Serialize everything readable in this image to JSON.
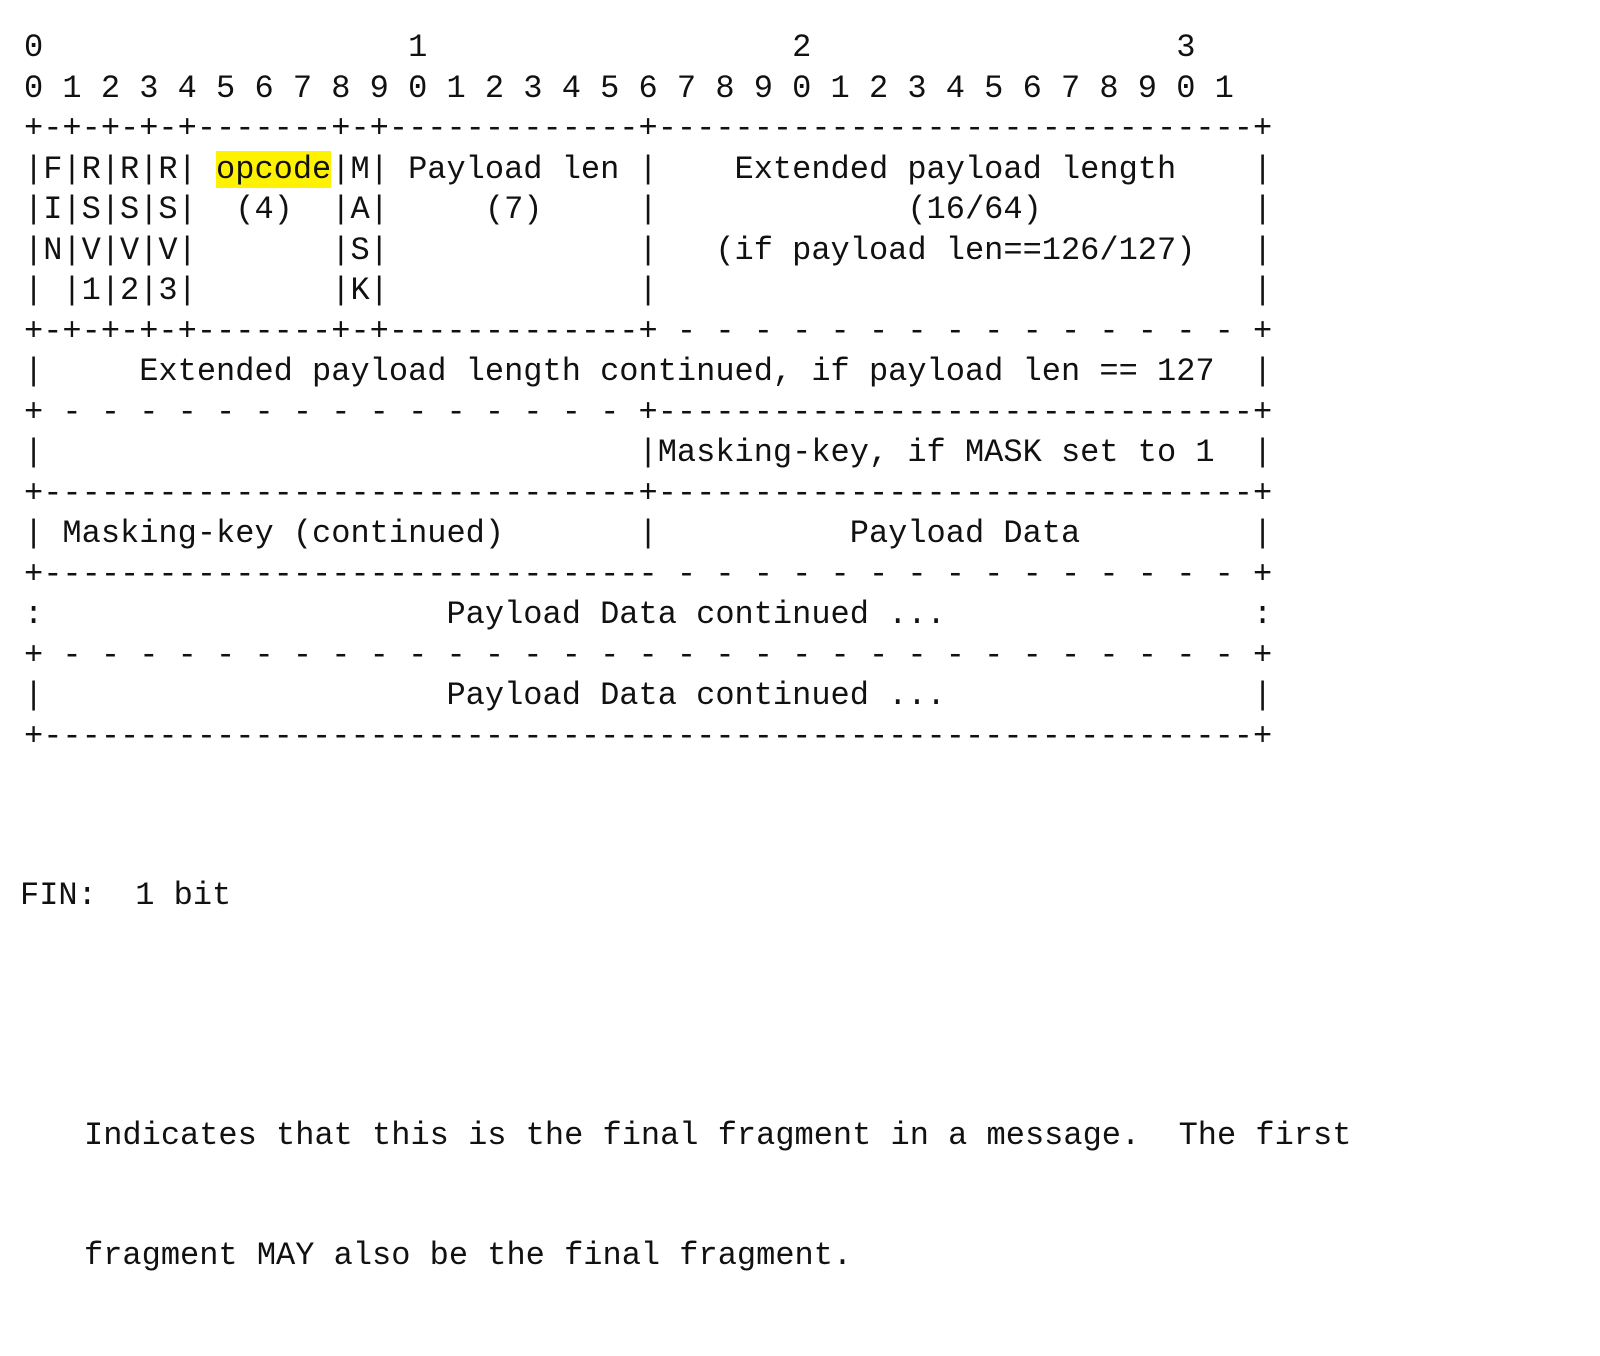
{
  "diagram": {
    "bit_tens": "0                   1                   2                   3",
    "bit_ones": "0 1 2 3 4 5 6 7 8 9 0 1 2 3 4 5 6 7 8 9 0 1 2 3 4 5 6 7 8 9 0 1",
    "border1": "+-+-+-+-+-------+-+-------------+-------------------------------+",
    "hdr1_pre": "|F|R|R|R| ",
    "hdr1_opcode": "opcode",
    "hdr1_post": "|M| Payload len |    Extended payload length    |",
    "hdr2": "|I|S|S|S|  (4)  |A|     (7)     |             (16/64)           |",
    "hdr3": "|N|V|V|V|       |S|             |   (if payload len==126/127)   |",
    "hdr4": "| |1|2|3|       |K|             |                               |",
    "border2": "+-+-+-+-+-------+-+-------------+ - - - - - - - - - - - - - - - +",
    "ext_cont": "|     Extended payload length continued, if payload len == 127  |",
    "border3": "+ - - - - - - - - - - - - - - - +-------------------------------+",
    "mask_row": "|                               |Masking-key, if MASK set to 1  |",
    "border4": "+-------------------------------+-------------------------------+",
    "mask_cont_row": "| Masking-key (continued)       |          Payload Data         |",
    "border5": "+-------------------------------- - - - - - - - - - - - - - - - +",
    "payload_cont_a": ":                     Payload Data continued ...                :",
    "border6": "+ - - - - - - - - - - - - - - - - - - - - - - - - - - - - - - - +",
    "payload_cont_b": "|                     Payload Data continued ...                |",
    "border7": "+---------------------------------------------------------------+"
  },
  "description": {
    "field": "FIN:  1 bit",
    "line1": "Indicates that this is the final fragment in a message.  The first",
    "line2": "fragment MAY also be the final fragment."
  },
  "colors": {
    "highlight": "#fff200",
    "text": "#111111"
  }
}
